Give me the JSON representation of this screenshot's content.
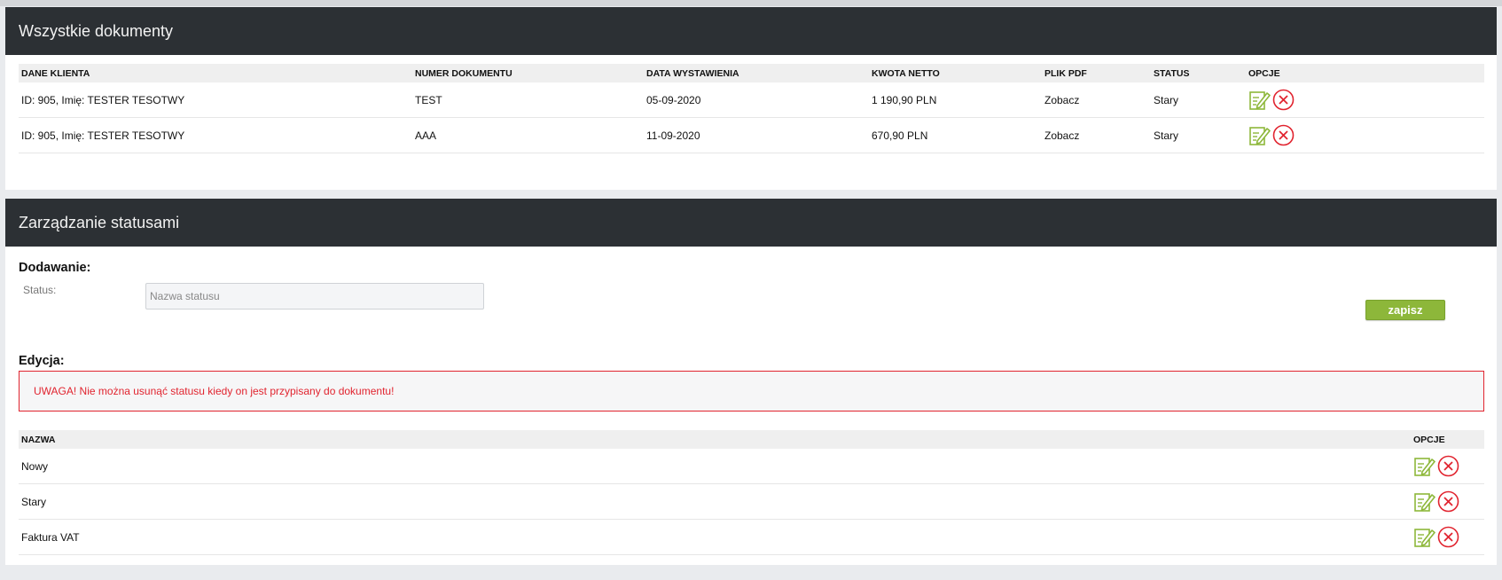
{
  "documents": {
    "title": "Wszystkie dokumenty",
    "columns": [
      "DANE KLIENTA",
      "NUMER DOKUMENTU",
      "DATA WYSTAWIENIA",
      "KWOTA NETTO",
      "PLIK PDF",
      "STATUS",
      "OPCJE"
    ],
    "rows": [
      {
        "client": "ID: 905, Imię: TESTER TESOTWY",
        "number": "TEST",
        "date": "05-09-2020",
        "amount": "1 190,90 PLN",
        "pdf": "Zobacz",
        "status": "Stary"
      },
      {
        "client": "ID: 905, Imię: TESTER TESOTWY",
        "number": "AAA",
        "date": "11-09-2020",
        "amount": "670,90 PLN",
        "pdf": "Zobacz",
        "status": "Stary"
      }
    ]
  },
  "statuses": {
    "title": "Zarządzanie statusami",
    "add_label": "Dodawanie:",
    "status_label": "Status:",
    "status_input": {
      "value": "",
      "placeholder": "Nazwa statusu"
    },
    "save_label": "zapisz",
    "edit_label": "Edycja:",
    "warning": "UWAGA! Nie można usunąć statusu kiedy on jest przypisany do dokumentu!",
    "columns": [
      "NAZWA",
      "OPCJE"
    ],
    "rows": [
      {
        "name": "Nowy"
      },
      {
        "name": "Stary"
      },
      {
        "name": "Faktura VAT"
      }
    ]
  },
  "icons": {
    "edit": "edit-icon",
    "delete": "delete-icon"
  },
  "colors": {
    "header_bg": "#2c3034",
    "accent_green": "#8db73a",
    "danger_red": "#e1242f"
  }
}
